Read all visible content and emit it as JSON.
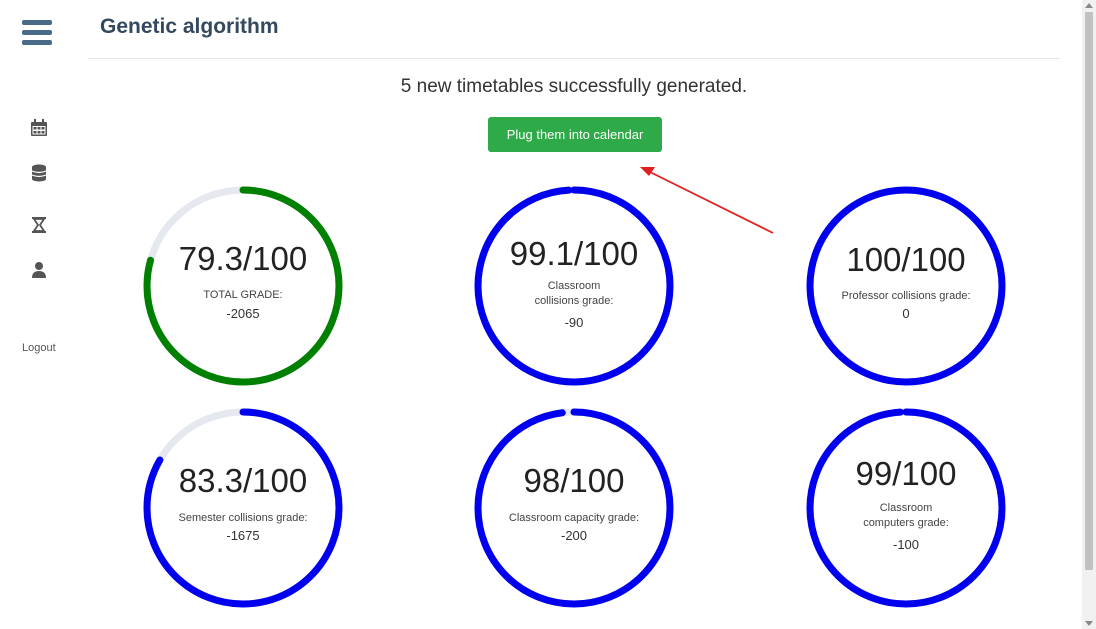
{
  "header": {
    "title": "Genetic algorithm"
  },
  "sidebar": {
    "icons": [
      "menu-icon",
      "calendar-icon",
      "database-icon",
      "hourglass-icon",
      "user-icon"
    ],
    "logout_label": "Logout"
  },
  "main": {
    "message": "5 new timetables successfully generated.",
    "plug_button_label": "Plug them into calendar"
  },
  "gauges": [
    {
      "score": "79.3/100",
      "label": "TOTAL GRADE:",
      "value": "-2065",
      "fill": 0.793,
      "color": "#008000"
    },
    {
      "score": "99.1/100",
      "label": "Classroom collisions grade:",
      "value": "-90",
      "fill": 0.991,
      "color": "#0000ee"
    },
    {
      "score": "100/100",
      "label": "Professor collisions grade:",
      "value": "0",
      "fill": 1.0,
      "color": "#0000ee"
    },
    {
      "score": "83.3/100",
      "label": "Semester collisions grade:",
      "value": "-1675",
      "fill": 0.833,
      "color": "#0000ee"
    },
    {
      "score": "98/100",
      "label": "Classroom capacity grade:",
      "value": "-200",
      "fill": 0.98,
      "color": "#0000ee"
    },
    {
      "score": "99/100",
      "label": "Classroom computers grade:",
      "value": "-100",
      "fill": 0.99,
      "color": "#0000ee"
    }
  ],
  "colors": {
    "track": "#e6e8ef",
    "button": "#2eaa49",
    "annotation_arrow": "#e02020"
  }
}
